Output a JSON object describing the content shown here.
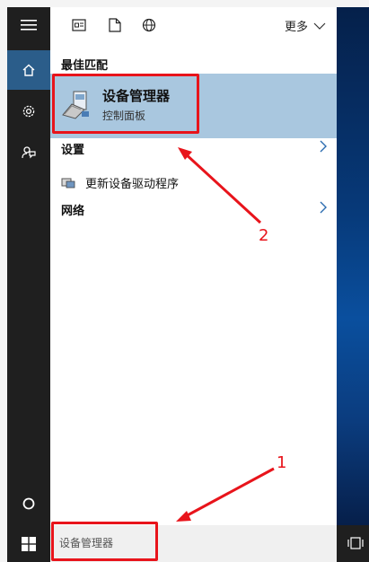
{
  "topbar": {
    "more_label": "更多",
    "icons": [
      "document-icon",
      "file-icon",
      "globe-icon"
    ]
  },
  "rail": {
    "items": [
      "hamburger-icon",
      "home-icon",
      "gear-icon",
      "feedback-icon",
      "cortana-icon",
      "windows-start-icon"
    ]
  },
  "best_match": {
    "heading": "最佳匹配",
    "title": "设备管理器",
    "subtitle": "控制面板"
  },
  "settings": {
    "heading": "设置",
    "item_label": "更新设备驱动程序"
  },
  "network": {
    "heading": "网络"
  },
  "search": {
    "value": "设备管理器"
  },
  "annotations": {
    "label_1": "1",
    "label_2": "2"
  },
  "colors": {
    "accent": "#2b5d8a",
    "highlight": "#a9c7df",
    "annotation": "#e8141b",
    "rail": "#1f1f1f"
  }
}
